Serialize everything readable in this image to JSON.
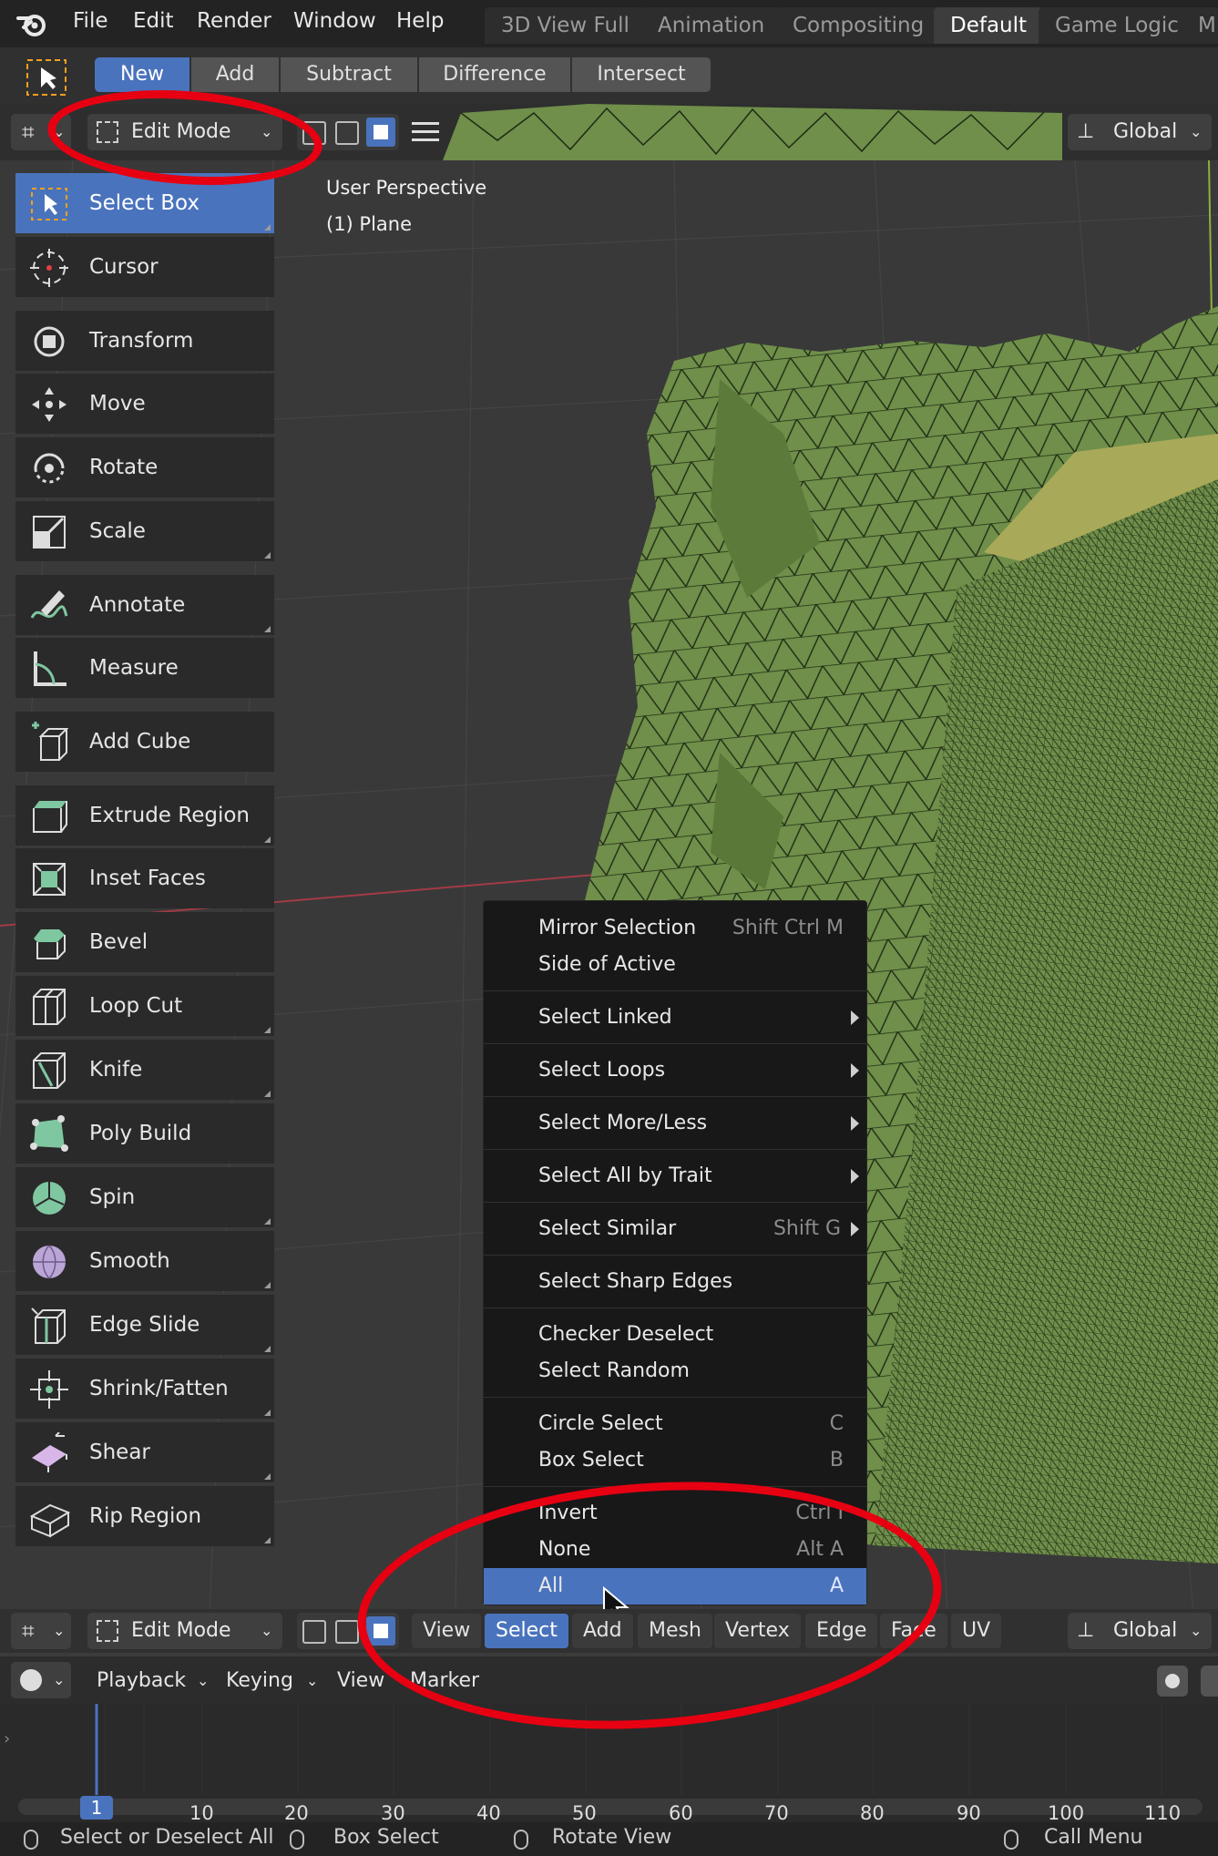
{
  "menubar": {
    "items": [
      "File",
      "Edit",
      "Render",
      "Window",
      "Help"
    ],
    "workspaces": [
      "3D View Full",
      "Animation",
      "Compositing",
      "Default",
      "Game Logic",
      "M"
    ],
    "active_workspace": "Default"
  },
  "tool_settings": {
    "modes": [
      "New",
      "Add",
      "Subtract",
      "Difference",
      "Intersect"
    ],
    "active_mode": "New"
  },
  "viewport_header": {
    "mode": "Edit Mode",
    "orientation": "Global"
  },
  "viewport": {
    "overlay_line1": "User Perspective",
    "overlay_line2": "(1) Plane"
  },
  "toolbar": {
    "tools": [
      {
        "label": "Select Box",
        "icon": "select-box-icon",
        "active": true
      },
      {
        "label": "Cursor",
        "icon": "cursor-icon"
      },
      {
        "label": "Transform",
        "icon": "transform-icon"
      },
      {
        "label": "Move",
        "icon": "move-icon"
      },
      {
        "label": "Rotate",
        "icon": "rotate-icon"
      },
      {
        "label": "Scale",
        "icon": "scale-icon"
      },
      {
        "label": "Annotate",
        "icon": "annotate-icon"
      },
      {
        "label": "Measure",
        "icon": "measure-icon"
      },
      {
        "label": "Add Cube",
        "icon": "add-cube-icon"
      },
      {
        "label": "Extrude Region",
        "icon": "extrude-region-icon"
      },
      {
        "label": "Inset Faces",
        "icon": "inset-faces-icon"
      },
      {
        "label": "Bevel",
        "icon": "bevel-icon"
      },
      {
        "label": "Loop Cut",
        "icon": "loop-cut-icon"
      },
      {
        "label": "Knife",
        "icon": "knife-icon"
      },
      {
        "label": "Poly Build",
        "icon": "poly-build-icon"
      },
      {
        "label": "Spin",
        "icon": "spin-icon"
      },
      {
        "label": "Smooth",
        "icon": "smooth-icon"
      },
      {
        "label": "Edge Slide",
        "icon": "edge-slide-icon"
      },
      {
        "label": "Shrink/Fatten",
        "icon": "shrink-fatten-icon"
      },
      {
        "label": "Shear",
        "icon": "shear-icon"
      },
      {
        "label": "Rip Region",
        "icon": "rip-region-icon"
      }
    ]
  },
  "select_menu": {
    "items": [
      {
        "label": "Mirror Selection",
        "shortcut": "Shift Ctrl M"
      },
      {
        "label": "Side of Active",
        "shortcut": ""
      },
      {
        "label": "Select Linked",
        "shortcut": "",
        "submenu": true
      },
      {
        "label": "Select Loops",
        "shortcut": "",
        "submenu": true
      },
      {
        "label": "Select More/Less",
        "shortcut": "",
        "submenu": true
      },
      {
        "label": "Select All by Trait",
        "shortcut": "",
        "submenu": true
      },
      {
        "label": "Select Similar",
        "shortcut": "Shift G",
        "submenu": true
      },
      {
        "label": "Select Sharp Edges",
        "shortcut": ""
      },
      {
        "label": "Checker Deselect",
        "shortcut": ""
      },
      {
        "label": "Select Random",
        "shortcut": ""
      },
      {
        "label": "Circle Select",
        "shortcut": "C"
      },
      {
        "label": "Box Select",
        "shortcut": "B"
      },
      {
        "label": "Invert",
        "shortcut": "Ctrl I"
      },
      {
        "label": "None",
        "shortcut": "Alt A"
      },
      {
        "label": "All",
        "shortcut": "A",
        "highlighted": true
      }
    ]
  },
  "bottom_header": {
    "mode": "Edit Mode",
    "menus": [
      "View",
      "Select",
      "Add",
      "Mesh",
      "Vertex",
      "Edge",
      "Face",
      "UV"
    ],
    "active_menu": "Select",
    "orientation": "Global"
  },
  "timeline": {
    "menus": [
      "Playback",
      "Keying",
      "View",
      "Marker"
    ],
    "current_frame": "1",
    "frame_labels": [
      "10",
      "20",
      "30",
      "40",
      "50",
      "60",
      "70",
      "80",
      "90",
      "100",
      "110"
    ]
  },
  "statusbar": {
    "left": "Select or Deselect All",
    "middle": "Box Select",
    "right": "Rotate View",
    "far_right": "Call Menu"
  },
  "colors": {
    "accent": "#4a73bd",
    "annotation": "#e60012",
    "mesh": "#6f8f4a"
  }
}
